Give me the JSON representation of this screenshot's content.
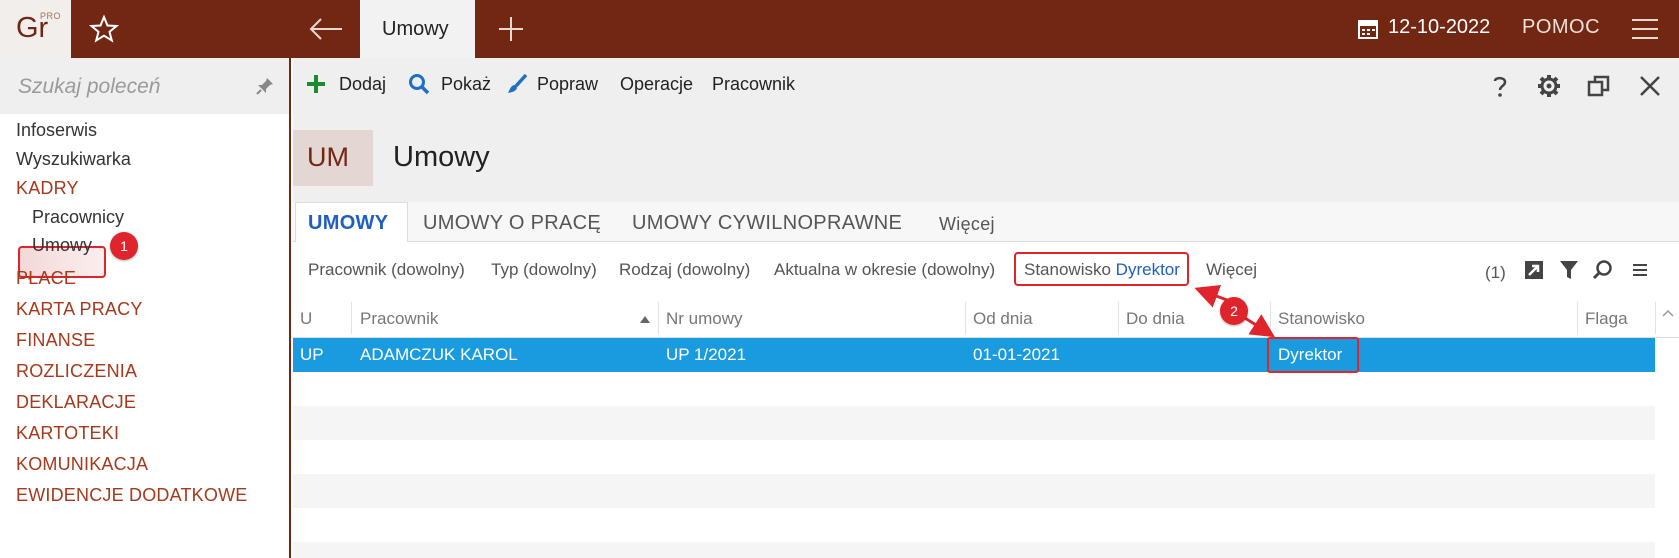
{
  "app": {
    "logo_text": "Gr",
    "logo_sup": "PRO",
    "active_tab": "Umowy",
    "date": "12-10-2022",
    "help": "POMOC"
  },
  "sidebar": {
    "search_placeholder": "Szukaj poleceń",
    "items": [
      {
        "label": "Infoserwis"
      },
      {
        "label": "Wyszukiwarka"
      },
      {
        "label": "KADRY"
      },
      {
        "label": "Pracownicy"
      },
      {
        "label": "Umowy"
      },
      {
        "label": "PŁACE"
      },
      {
        "label": "KARTA PRACY"
      },
      {
        "label": "FINANSE"
      },
      {
        "label": "ROZLICZENIA"
      },
      {
        "label": "DEKLARACJE"
      },
      {
        "label": "KARTOTEKI"
      },
      {
        "label": "KOMUNIKACJA"
      },
      {
        "label": "EWIDENCJE DODATKOWE"
      }
    ]
  },
  "toolbar": {
    "add": "Dodaj",
    "show": "Pokaż",
    "edit": "Popraw",
    "operations": "Operacje",
    "employee": "Pracownik"
  },
  "header": {
    "abbr": "UM",
    "title": "Umowy"
  },
  "tabs": [
    {
      "label": "UMOWY"
    },
    {
      "label": "UMOWY O PRACĘ"
    },
    {
      "label": "UMOWY CYWILNOPRAWNE"
    },
    {
      "label": "Więcej"
    }
  ],
  "filters": {
    "employee": "Pracownik (dowolny)",
    "type": "Typ (dowolny)",
    "kind": "Rodzaj (dowolny)",
    "current": "Aktualna w okresie (dowolny)",
    "position_label": "Stanowisko",
    "position_value": "Dyrektor",
    "more": "Więcej",
    "count": "(1)"
  },
  "grid": {
    "columns": [
      "U",
      "Pracownik",
      "Nr umowy",
      "Od dnia",
      "Do dnia",
      "Stanowisko",
      "Flaga"
    ],
    "rows": [
      {
        "u": "UP",
        "employee": "ADAMCZUK KAROL",
        "number": "UP 1/2021",
        "from": "01-01-2021",
        "to": "",
        "position": "Dyrektor",
        "flag": ""
      }
    ]
  },
  "annotations": {
    "badge1": "1",
    "badge2": "2"
  },
  "colors": {
    "brand": "#722713",
    "category": "#a6381b",
    "selected_row": "#1a9be0",
    "highlight": "#e0242b",
    "accent_blue": "#1f5fbf"
  }
}
